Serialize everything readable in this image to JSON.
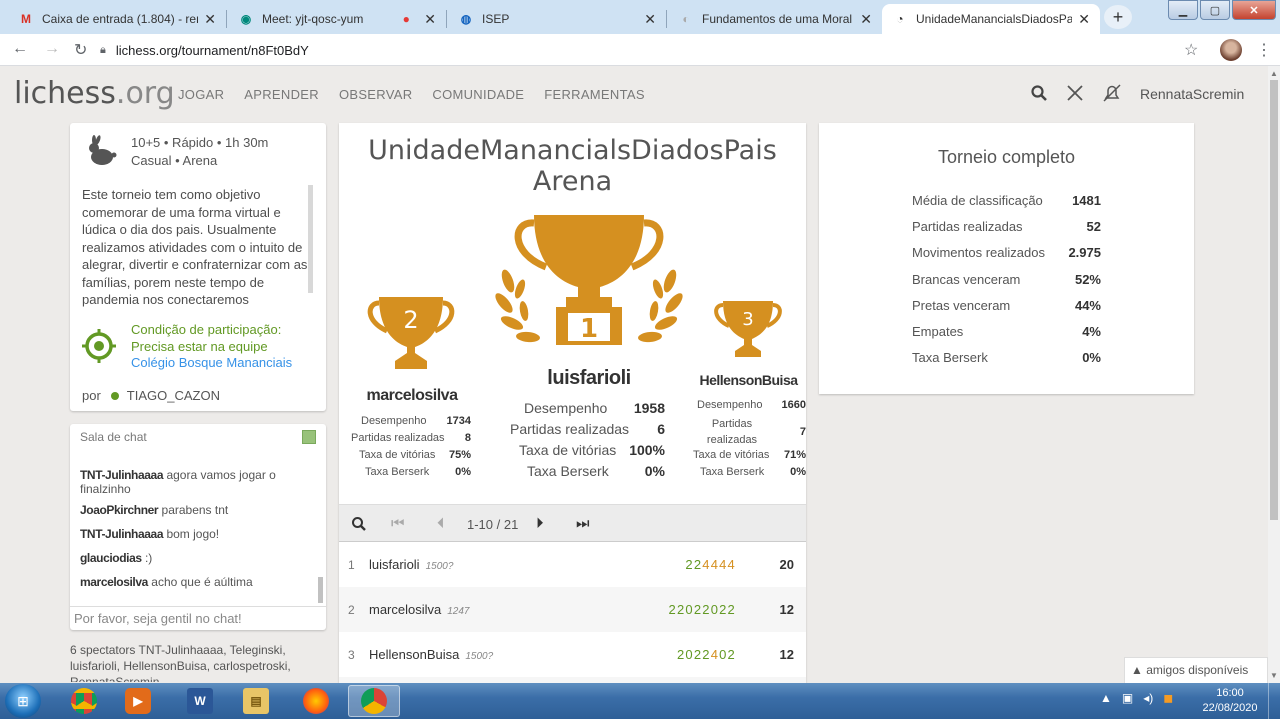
{
  "browser": {
    "tabs": [
      {
        "icon": "M",
        "title": "Caixa de entrada (1.804) - renna",
        "active": false
      },
      {
        "icon": "◉",
        "title": "Meet: yjt-qosc-yum",
        "active": false
      },
      {
        "icon": "◍",
        "title": "ISEP",
        "active": false
      },
      {
        "icon": "◐",
        "title": "Fundamentos de uma Moral de",
        "active": false
      },
      {
        "icon": "◔",
        "title": "UnidadeManancialsDiadosPais",
        "active": true
      }
    ],
    "url": "lichess.org/tournament/n8Ft0BdY"
  },
  "site": {
    "logo_main": "lichess",
    "logo_suffix": ".org",
    "nav": [
      "JOGAR",
      "APRENDER",
      "OBSERVAR",
      "COMUNIDADE",
      "FERRAMENTAS"
    ],
    "username": "RennataScremin"
  },
  "tournament_info": {
    "setup_line1": "10+5 • Rápido • 1h 30m",
    "setup_line2": "Casual • Arena",
    "description": "Este torneio tem como objetivo comemorar de uma forma virtual e lúdica o dia dos pais. Usualmente realizamos atividades com o intuito de alegrar, divertir e confraternizar com as famílias, porem neste tempo de pandemia nos conectaremos",
    "condition_line1": "Condição de participação:",
    "condition_line2": "Precisa estar na equipe",
    "condition_team": "Colégio Bosque Mananciais",
    "by_label": "por",
    "creator": "TIAGO_CAZON"
  },
  "chat": {
    "title": "Sala de chat",
    "messages": [
      {
        "user": "TNT-Julinhaaaa",
        "text": "agora vamos jogar o finalzinho"
      },
      {
        "user": "JoaoPkirchner",
        "text": "parabens tnt"
      },
      {
        "user": "TNT-Julinhaaaa",
        "text": "bom jogo!"
      },
      {
        "user": "glauciodias",
        "text": ":)"
      },
      {
        "user": "marcelosilva",
        "text": "acho que é aúltima"
      }
    ],
    "placeholder": "Por favor, seja gentil no chat!"
  },
  "spectators": "6 spectators TNT-Julinhaaaa, Teleginski, luisfarioli, HellensonBuisa, carlospetroski, RennataScremin",
  "center": {
    "name_line1": "UnidadeManancialsDiadosPais",
    "name_line2": "Arena",
    "podium": [
      {
        "rank": "1",
        "name": "luisfarioli",
        "stats": [
          [
            "Desempenho",
            "1958"
          ],
          [
            "Partidas realizadas",
            "6"
          ],
          [
            "Taxa de vitórias",
            "100%"
          ],
          [
            "Taxa Berserk",
            "0%"
          ]
        ]
      },
      {
        "rank": "2",
        "name": "marcelosilva",
        "stats": [
          [
            "Desempenho",
            "1734"
          ],
          [
            "Partidas realizadas",
            "8"
          ],
          [
            "Taxa de vitórias",
            "75%"
          ],
          [
            "Taxa Berserk",
            "0%"
          ]
        ]
      },
      {
        "rank": "3",
        "name": "HellensonBuisa",
        "stats": [
          [
            "Desempenho",
            "1660"
          ],
          [
            "Partidas realizadas",
            "7"
          ],
          [
            "Taxa de vitórias",
            "71%"
          ],
          [
            "Taxa Berserk",
            "0%"
          ]
        ]
      }
    ],
    "pagination": "1-10 / 21",
    "standings": [
      {
        "rank": "1",
        "name": "luisfarioli",
        "rating": "1500?",
        "sheet_green": "22",
        "sheet_orange": "4444",
        "score": "20"
      },
      {
        "rank": "2",
        "name": "marcelosilva",
        "rating": "1247",
        "sheet_green": "22022022",
        "sheet_orange": "",
        "score": "12"
      },
      {
        "rank": "3",
        "name": "HellensonBuisa",
        "rating": "1500?",
        "sheet_green": "2022",
        "sheet_orange": "4",
        "sheet_tail": "02",
        "score": "12"
      }
    ]
  },
  "stats_panel": {
    "title": "Torneio completo",
    "rows": [
      [
        "Média de classificação",
        "1481"
      ],
      [
        "Partidas realizadas",
        "52"
      ],
      [
        "Movimentos realizados",
        "2.975"
      ],
      [
        "Brancas venceram",
        "52%"
      ],
      [
        "Pretas venceram",
        "44%"
      ],
      [
        "Empates",
        "4%"
      ],
      [
        "Taxa Berserk",
        "0%"
      ]
    ]
  },
  "friends": "▲ amigos disponíveis",
  "taskbar": {
    "time": "16:00",
    "date": "22/08/2020"
  },
  "colors": {
    "gold": "#d59020",
    "green": "#629924",
    "link": "#3692e7"
  }
}
